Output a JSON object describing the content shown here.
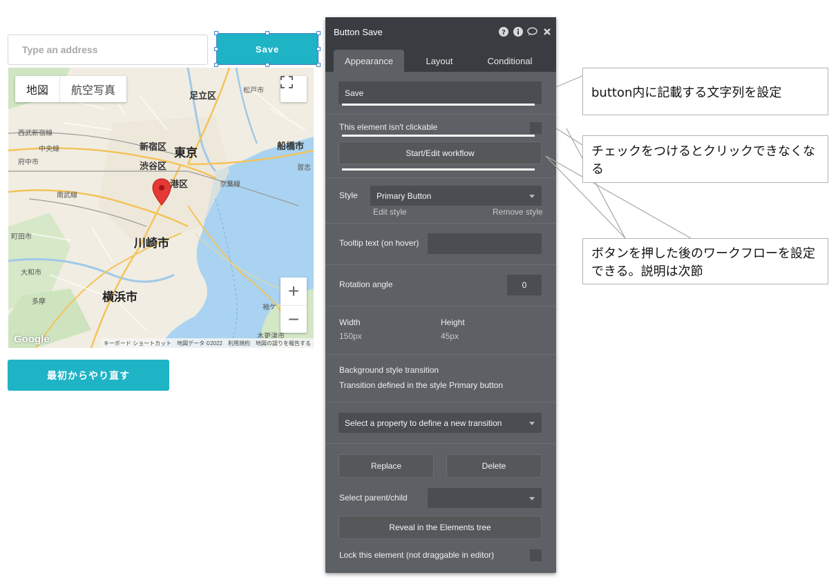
{
  "canvas": {
    "address_input": {
      "placeholder": "Type an address"
    },
    "save_button": {
      "label": "Save"
    },
    "restart_button": {
      "label": "最初からやり直す"
    },
    "map": {
      "type_controls": {
        "map": "地図",
        "satellite": "航空写真"
      },
      "zoom_in": "+",
      "zoom_out": "−",
      "labels": {
        "tokyo": "東京",
        "shinjuku": "新宿区",
        "shibuya": "渋谷区",
        "minato": "港区",
        "adachi": "足立区",
        "matsudo": "松戸市",
        "funabashi": "船橋市",
        "kawasaki": "川崎市",
        "yokohama": "横浜市",
        "nishitokyo": "西武新宿線",
        "chuosen": "中央線",
        "fuchu": "府中市",
        "nambu": "南武線",
        "keiyo": "京葉線",
        "machida": "町田市",
        "yamato": "大和市",
        "narashino": "習志",
        "kisarazu": "木更津市",
        "sodegaura": "袖ケ",
        "tama": "多摩"
      },
      "google_logo": "Google",
      "attribution": [
        "キーボード ショートカット",
        "地図データ ©2022",
        "利用規約",
        "地図の誤りを報告する"
      ]
    }
  },
  "panel": {
    "title": "Button Save",
    "header_icons": [
      "help-icon",
      "info-icon",
      "comment-icon",
      "close-icon"
    ],
    "tabs": [
      "Appearance",
      "Layout",
      "Conditional"
    ],
    "text_field": "Save",
    "not_clickable_label": "This element isn't clickable",
    "workflow_button": "Start/Edit workflow",
    "style": {
      "label": "Style",
      "value": "Primary Button",
      "edit": "Edit style",
      "remove": "Remove style"
    },
    "tooltip_label": "Tooltip text (on hover)",
    "rotation": {
      "label": "Rotation angle",
      "value": "0"
    },
    "width": {
      "label": "Width",
      "value": "150px"
    },
    "height": {
      "label": "Height",
      "value": "45px"
    },
    "transition": {
      "title": "Background style transition",
      "desc": "Transition defined in the style Primary button",
      "select": "Select a property to define a new transition"
    },
    "replace": "Replace",
    "delete": "Delete",
    "parent_child": "Select parent/child",
    "reveal": "Reveal in the Elements tree",
    "lock": "Lock this element (not draggable in editor)"
  },
  "callouts": {
    "text": "button内に記載する文字列を設定",
    "clickable": "チェックをつけるとクリックできなくなる",
    "workflow_line1": "ボタンを押した後のワークフローを設定",
    "workflow_line2": "できる。説明は次節"
  },
  "colors": {
    "accent": "#1fb3c6",
    "panel_bg": "#5d6064",
    "panel_header": "#393c40",
    "selection": "#3b7fc4"
  }
}
